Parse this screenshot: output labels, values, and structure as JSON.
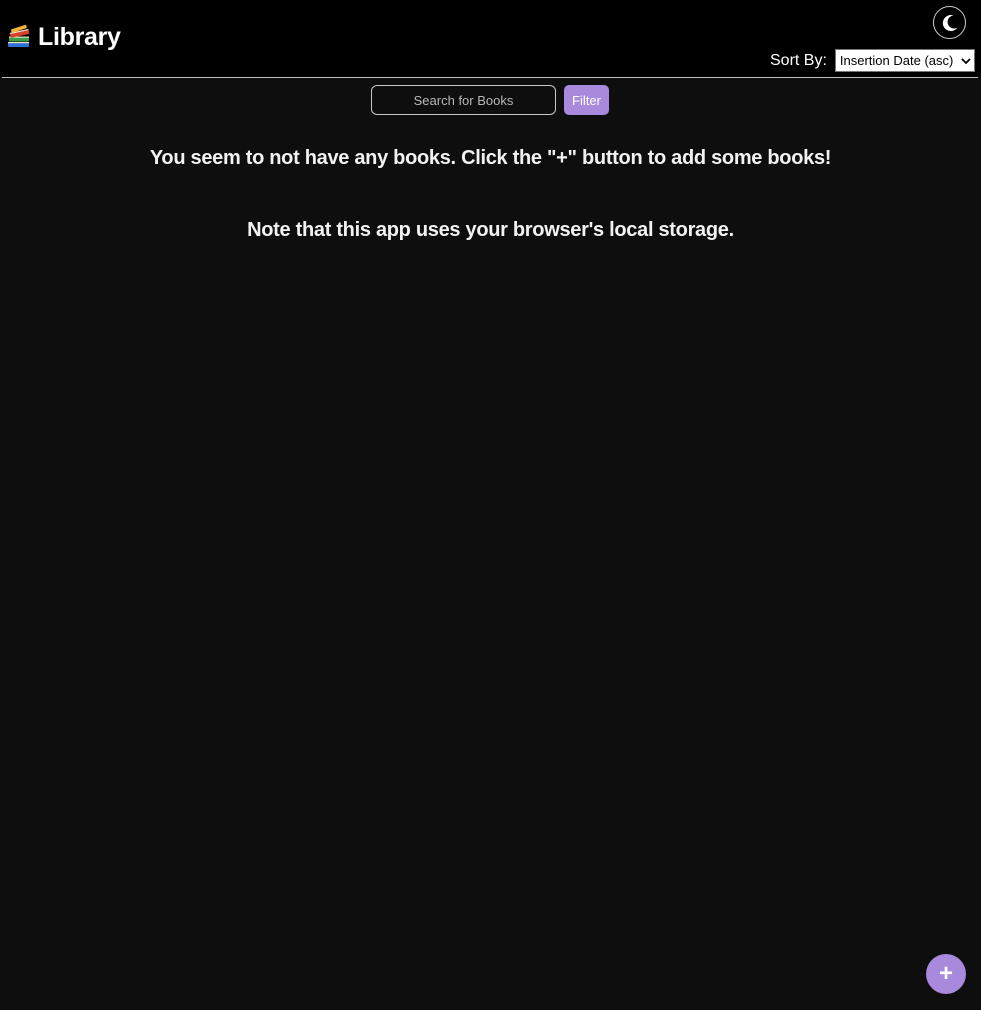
{
  "header": {
    "title": "Library",
    "logo_icon": "books-stack-icon",
    "theme_toggle_icon": "moon-icon",
    "sort": {
      "label": "Sort By:",
      "selected": "Insertion Date (asc)"
    }
  },
  "search": {
    "placeholder": "Search for Books",
    "value": "",
    "filter_label": "Filter"
  },
  "main": {
    "empty_message": "You seem to not have any books. Click the \"+\" button to add some books!",
    "note": "Note that this app uses your browser's local storage."
  },
  "fab": {
    "label": "+",
    "icon": "plus-icon"
  },
  "colors": {
    "accent": "#a889dc",
    "background": "#0e0e0e",
    "header_background": "#000000"
  }
}
